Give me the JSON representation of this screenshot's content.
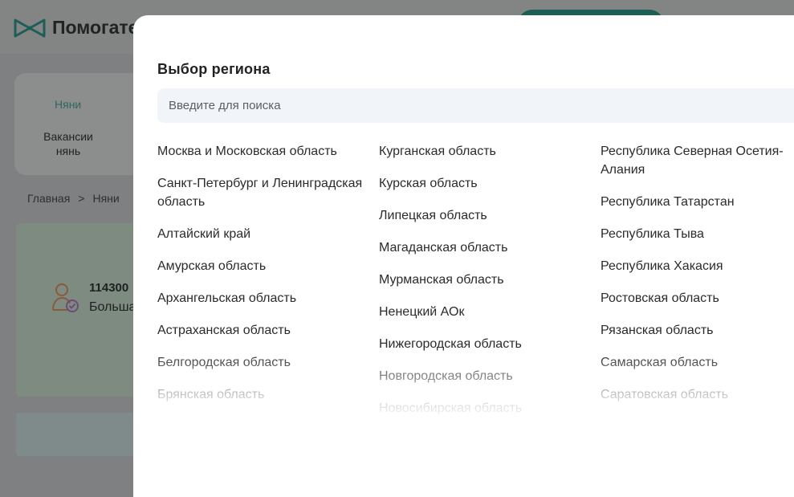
{
  "header": {
    "logo_text": "Помогате"
  },
  "bg": {
    "tab_active": "Няни",
    "tab_vacancies": "Вакансии нянь",
    "breadcrumb": [
      "Главная",
      "Няни"
    ],
    "card_number": "114300",
    "card_sub": "Больша"
  },
  "modal": {
    "title": "Выбор региона",
    "search_placeholder": "Введите для поиска",
    "columns": [
      [
        "Москва и Московская область",
        "Санкт-Петербург и Ленинградская область",
        "Алтайский край",
        "Амурская область",
        "Архангельская область",
        "Астраханская область",
        "Белгородская область",
        "Брянская область"
      ],
      [
        "Курганская область",
        "Курская область",
        "Липецкая область",
        "Магаданская область",
        "Мурманская область",
        "Ненецкий АОк",
        "Нижегородская область",
        "Новгородская область",
        "Новосибирская область"
      ],
      [
        "Республика Северная Осетия-Алания",
        "Республика Татарстан",
        "Республика Тыва",
        "Республика Хакасия",
        "Ростовская область",
        "Рязанская область",
        "Самарская область",
        "Саратовская область"
      ]
    ]
  },
  "colors": {
    "accent": "#2a9d8f",
    "overlay": "#7f8081",
    "search_bg": "#f1f4f8"
  }
}
